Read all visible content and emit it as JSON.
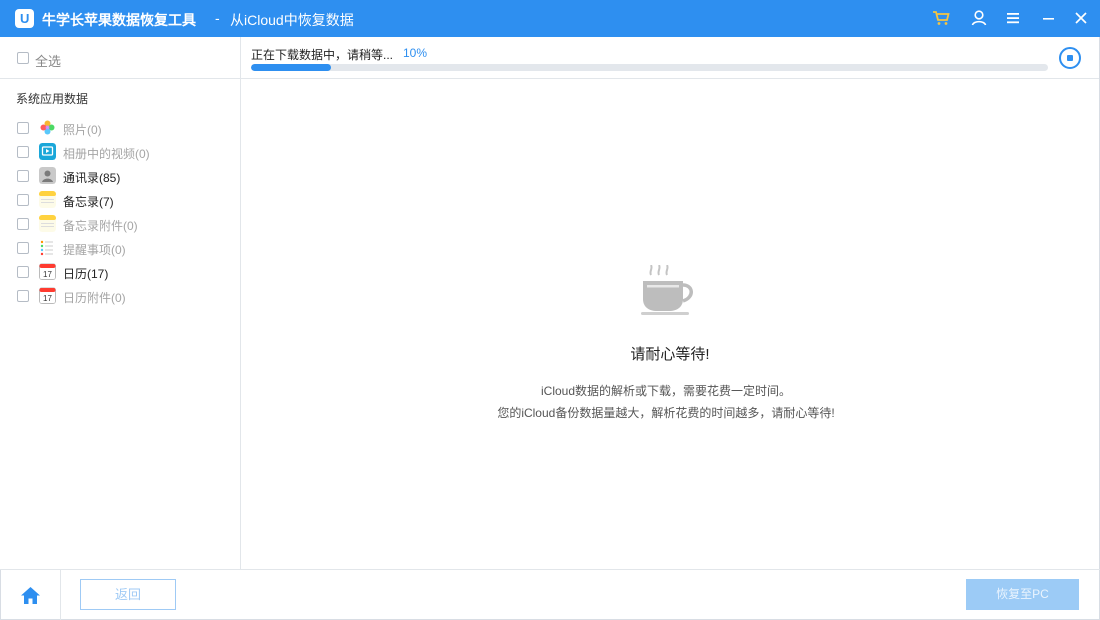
{
  "titlebar": {
    "app_title": "牛学长苹果数据恢复工具",
    "separator": "-",
    "subtitle": "从iCloud中恢复数据",
    "logo_letter": "U",
    "buttons": [
      "cart-icon",
      "user-icon",
      "menu-icon",
      "minimize-icon",
      "close-icon"
    ],
    "cart_color": "#f5c542"
  },
  "sidebar": {
    "select_all": "全选",
    "section_title": "系统应用数据",
    "items": [
      {
        "label": "照片(0)",
        "icon": "photos-icon",
        "active": false
      },
      {
        "label": "相册中的视频(0)",
        "icon": "album-video-icon",
        "active": false
      },
      {
        "label": "通讯录(85)",
        "icon": "contacts-icon",
        "active": true
      },
      {
        "label": "备忘录(7)",
        "icon": "notes-icon",
        "active": true
      },
      {
        "label": "备忘录附件(0)",
        "icon": "notes-attachment-icon",
        "active": false
      },
      {
        "label": "提醒事项(0)",
        "icon": "reminders-icon",
        "active": false
      },
      {
        "label": "日历(17)",
        "icon": "calendar-icon",
        "active": true
      },
      {
        "label": "日历附件(0)",
        "icon": "calendar-attachment-icon",
        "active": false
      }
    ]
  },
  "progress": {
    "text": "正在下载数据中，请稍等...",
    "percent_label": "10%",
    "fraction": 0.1
  },
  "main": {
    "wait_title": "请耐心等待!",
    "line1": "iCloud数据的解析或下载，需要花费一定时间。",
    "line2": "您的iCloud备份数据量越大，解析花费的时间越多，请耐心等待!"
  },
  "bottom": {
    "back_label": "返回",
    "recover_label": "恢复至PC"
  },
  "colors": {
    "accent": "#2e8ff0",
    "disabled_button": "#9ccbf6"
  }
}
